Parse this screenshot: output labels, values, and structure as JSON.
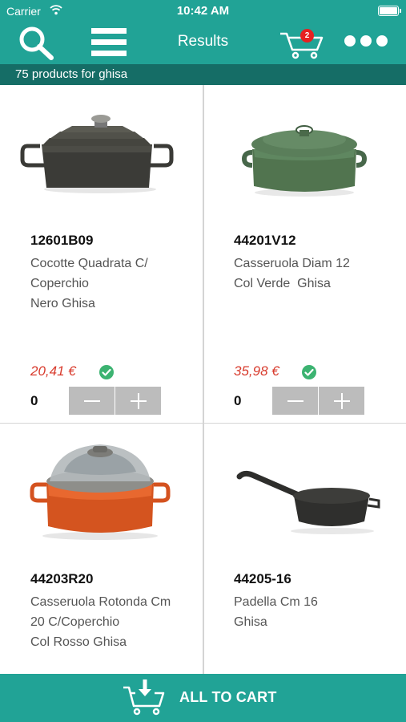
{
  "status_bar": {
    "carrier": "Carrier",
    "time": "10:42 AM"
  },
  "nav_bar": {
    "title": "Results",
    "cart_count": "2",
    "icons": [
      "search-icon",
      "menu-icon",
      "cart-icon",
      "more-icon"
    ]
  },
  "subheader": {
    "results_text": "75 products for ghisa"
  },
  "products": [
    {
      "code": "12601B09",
      "name": "Cocotte Quadrata C/ Coperchio Nero Ghisa",
      "name_lines": [
        "Cocotte Quadrata C/",
        "Coperchio",
        "Nero Ghisa"
      ],
      "price": "20,41 €",
      "available": true,
      "quantity": "0"
    },
    {
      "code": "44201V12",
      "name": "Casseruola Diam 12 Col Verde Ghisa",
      "name_lines": [
        "Casseruola Diam 12",
        "Col Verde  Ghisa"
      ],
      "price": "35,98 €",
      "available": true,
      "quantity": "0"
    },
    {
      "code": "44203R20",
      "name": "Casseruola Rotonda Cm 20 C/Coperchio Col Rosso Ghisa",
      "name_lines": [
        "Casseruola Rotonda Cm",
        "20 C/Coperchio",
        "Col Rosso Ghisa"
      ]
    },
    {
      "code": "44205-16",
      "name": "Padella Cm 16 Ghisa",
      "name_lines": [
        "Padella Cm 16",
        "Ghisa"
      ]
    }
  ],
  "bottom_bar": {
    "label": "ALL TO CART",
    "icon": "cart-download-icon"
  },
  "colors": {
    "primary": "#21a396",
    "primary_dark": "#156d66",
    "price": "#d83b2d",
    "check": "#3cb371",
    "stepper": "#bcbcbc",
    "badge": "#e62020"
  }
}
